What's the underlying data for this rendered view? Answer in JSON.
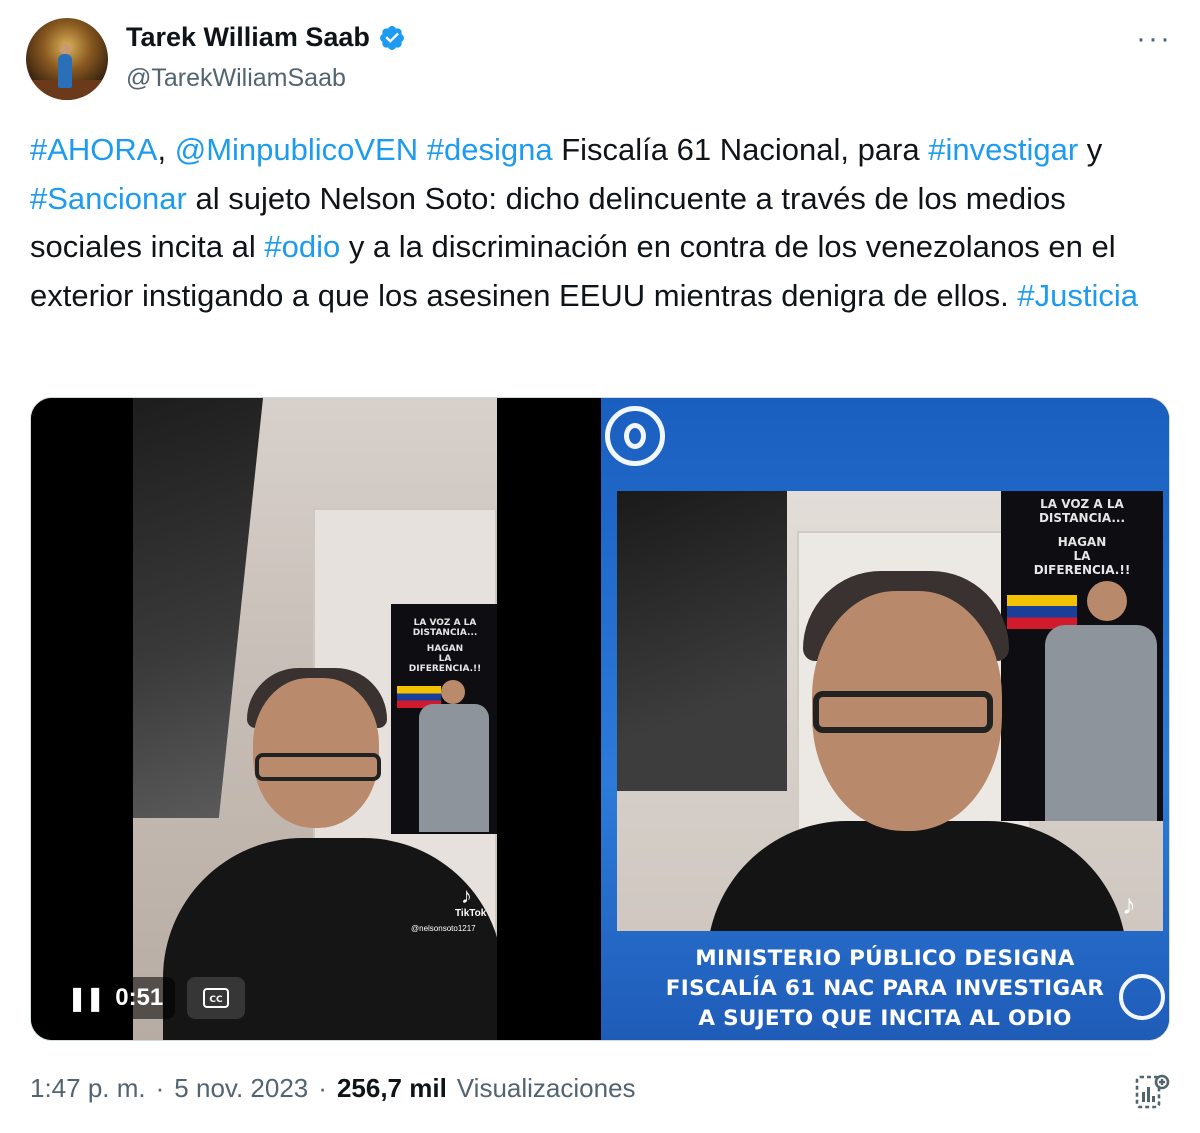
{
  "author": {
    "name": "Tarek William Saab",
    "handle": "@TarekWiliamSaab",
    "verified": true
  },
  "more_label": "···",
  "tweet": {
    "segments": [
      {
        "text": "#AHORA",
        "type": "hashtag"
      },
      {
        "text": ", ",
        "type": "text"
      },
      {
        "text": "@MinpublicoVEN",
        "type": "mention"
      },
      {
        "text": " ",
        "type": "text"
      },
      {
        "text": "#designa",
        "type": "hashtag"
      },
      {
        "text": " Fiscalía 61 Nacional, para ",
        "type": "text"
      },
      {
        "text": "#investigar",
        "type": "hashtag"
      },
      {
        "text": " y ",
        "type": "text"
      },
      {
        "text": "#Sancionar",
        "type": "hashtag"
      },
      {
        "text": " al sujeto Nelson Soto: dicho delincuente a través de los medios sociales incita al ",
        "type": "text"
      },
      {
        "text": "#odio",
        "type": "hashtag"
      },
      {
        "text": " y a la discriminación en contra de los venezolanos en el exterior instigando a que los asesinen EEUU mientras denigra de ellos.  ",
        "type": "text"
      },
      {
        "text": "#Justicia",
        "type": "hashtag"
      }
    ]
  },
  "video": {
    "time": "0:51",
    "pause_icon": "pause-icon",
    "cc_icon": "captions-icon",
    "tiktok_label": "TikTok",
    "tiktok_user": "@nelsonsoto1217"
  },
  "poster": {
    "line1": "LA VOZ A LA",
    "line2": "DISTANCIA...",
    "line3": "HAGAN",
    "line4": "LA",
    "line5": "DIFERENCIA.!!"
  },
  "image_caption": {
    "line1": "MINISTERIO PÚBLICO DESIGNA",
    "line2": "FISCALÍA 61 NAC PARA INVESTIGAR",
    "line3": "A SUJETO QUE INCITA AL ODIO"
  },
  "meta": {
    "time": "1:47 p. m.",
    "sep1": "·",
    "date": "5 nov. 2023",
    "sep2": "·",
    "views_count": "256,7 mil",
    "views_label": "Visualizaciones"
  },
  "colors": {
    "link": "#1d9bf0",
    "verified": "#1d9bf0",
    "secondary_text": "#536471",
    "caption_bg": "#2c7bd9"
  }
}
